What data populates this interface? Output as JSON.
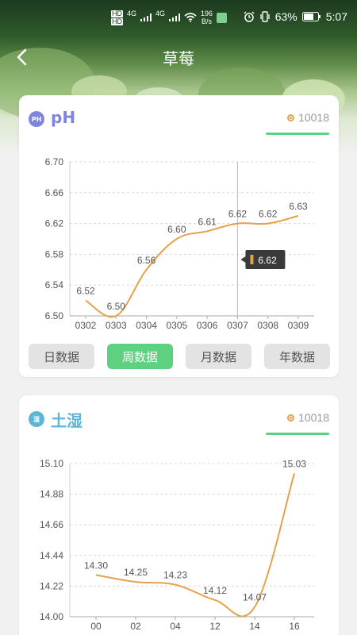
{
  "status_bar": {
    "net1": "HD",
    "net2": "HD",
    "sig1": "4G",
    "sig2": "4G",
    "speed": "196",
    "speed_unit": "B/s",
    "battery": "63%",
    "time": "5:07"
  },
  "nav": {
    "title": "草莓"
  },
  "cards": [
    {
      "icon_text": "PH",
      "name": "pH",
      "device": "10018",
      "periods": [
        "日数据",
        "周数据",
        "月数据",
        "年数据"
      ],
      "active_period": 1,
      "tooltip": "6.62",
      "chart_data": {
        "type": "line",
        "categories": [
          "0302",
          "0303",
          "0304",
          "0305",
          "0306",
          "0307",
          "0308",
          "0309"
        ],
        "values": [
          6.52,
          6.5,
          6.56,
          6.6,
          6.61,
          6.62,
          6.62,
          6.63
        ],
        "value_labels": [
          "6.52",
          "6.50",
          "6.56",
          "6.60",
          "6.61",
          "6.62",
          "6.62",
          "6.63"
        ],
        "yticks": [
          "6.70",
          "6.66",
          "6.62",
          "6.58",
          "6.54",
          "6.50"
        ],
        "ylim": [
          6.5,
          6.7
        ],
        "grid": true,
        "highlight_index": 5
      }
    },
    {
      "icon_text": "湿",
      "name": "土湿",
      "device": "10018",
      "chart_data": {
        "type": "line",
        "categories": [
          "00",
          "02",
          "04",
          "12",
          "14",
          "16"
        ],
        "values": [
          14.3,
          14.25,
          14.23,
          14.12,
          14.07,
          15.03
        ],
        "value_labels": [
          "14.30",
          "14.25",
          "14.23",
          "14.12",
          "14.07",
          "15.03"
        ],
        "yticks": [
          "15.10",
          "14.88",
          "14.66",
          "14.44",
          "14.22",
          "14.00"
        ],
        "ylim": [
          14.0,
          15.1
        ],
        "grid": true
      }
    }
  ],
  "colors": {
    "accent": "#5fcf80",
    "line": "#e6a24a",
    "ph_title": "#7f84dd",
    "moist_title": "#5db6d6"
  }
}
